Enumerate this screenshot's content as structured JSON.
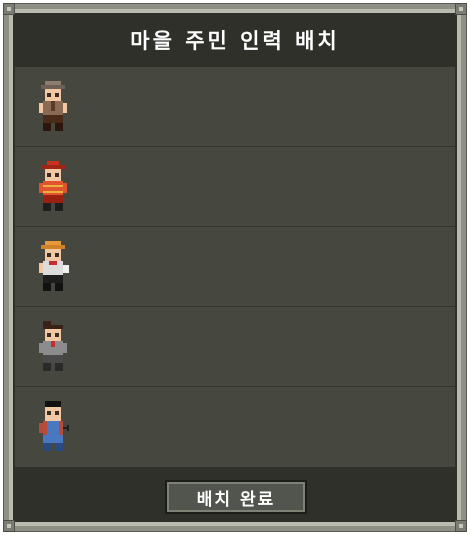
{
  "title": "마을 주민 인력 배치",
  "confirm_button": "배치 완료",
  "villagers": [
    {
      "icon": "farmer-villager-icon",
      "colors": {
        "hat": "#8c7d6e",
        "body": "#8a6a52",
        "pants": "#4a2a18"
      }
    },
    {
      "icon": "firefighter-villager-icon",
      "colors": {
        "hat": "#c8321e",
        "body": "#e0542e",
        "pants": "#9a2012"
      }
    },
    {
      "icon": "builder-villager-icon",
      "colors": {
        "hat": "#e89a3a",
        "body": "#dcdcdc",
        "pants": "#1e1e1e"
      }
    },
    {
      "icon": "merchant-villager-icon",
      "colors": {
        "hat": "#3a2218",
        "body": "#8c8c8c",
        "pants": "#4a4a4a"
      }
    },
    {
      "icon": "mechanic-villager-icon",
      "colors": {
        "hat": "#111111",
        "body": "#b84a3a",
        "pants": "#4a78c0"
      }
    }
  ]
}
